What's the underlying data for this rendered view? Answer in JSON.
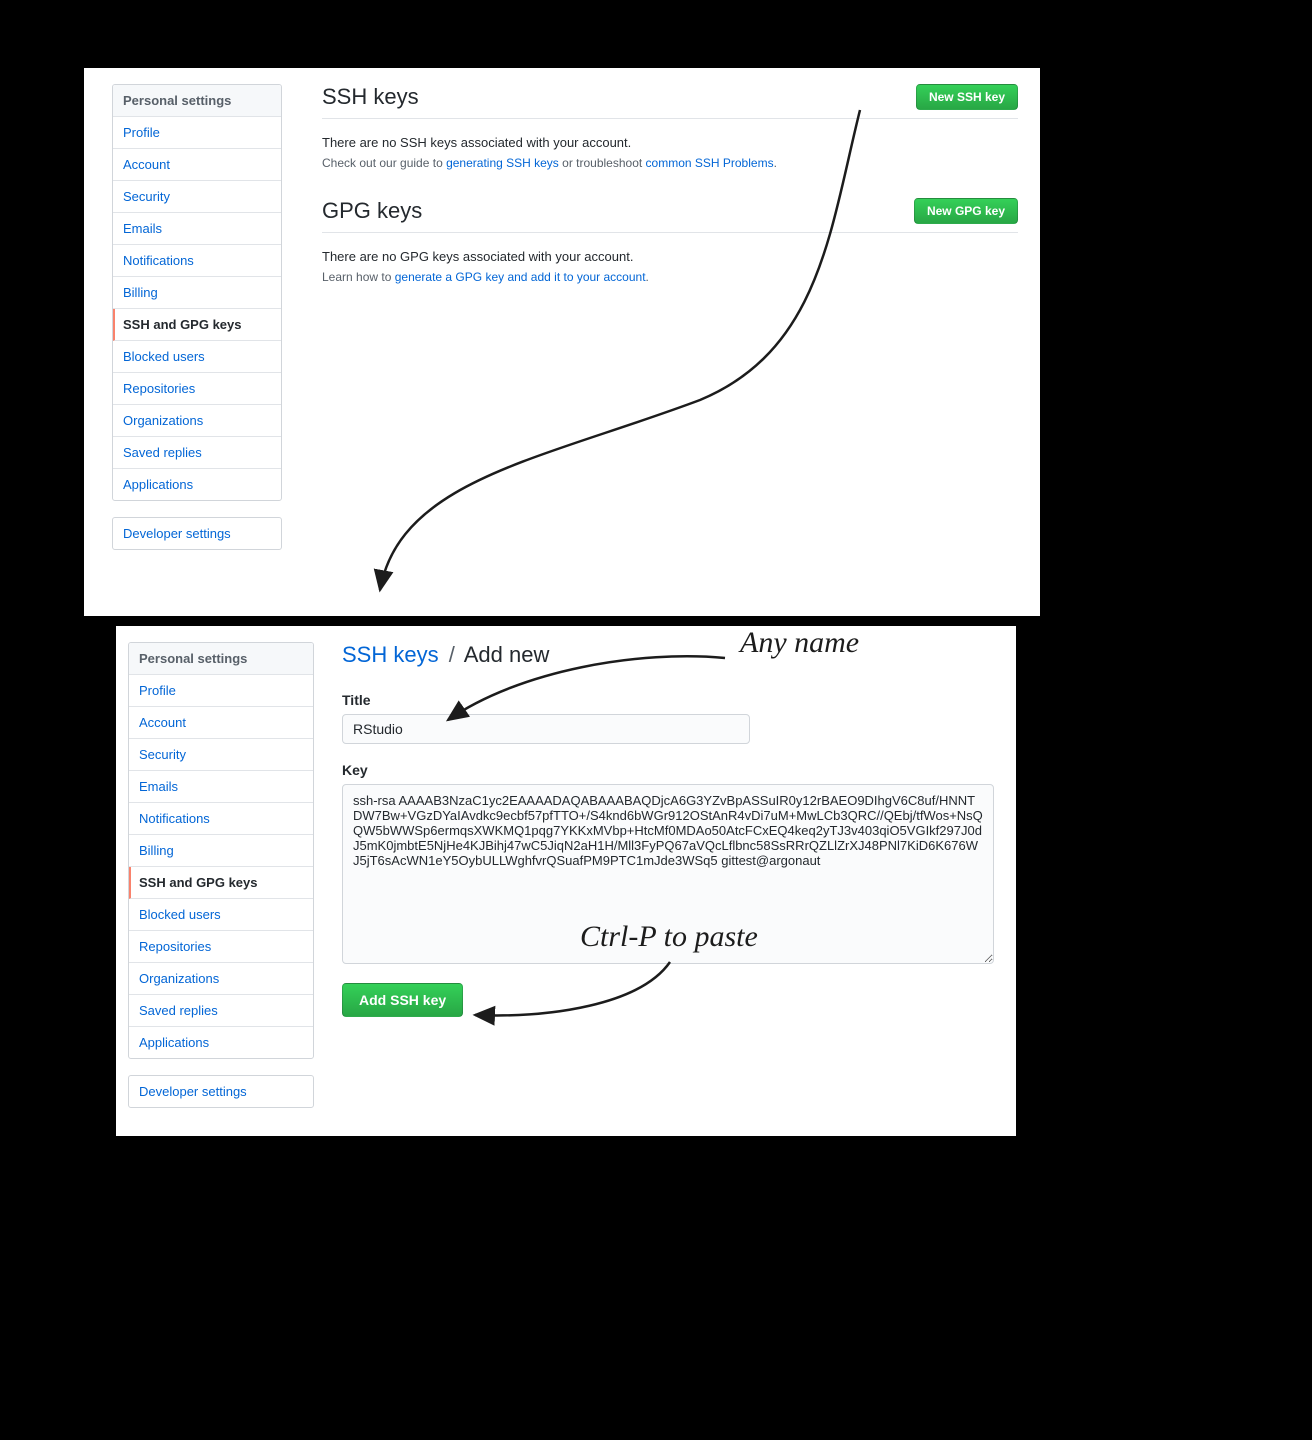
{
  "sidebar": {
    "header": "Personal settings",
    "items": [
      "Profile",
      "Account",
      "Security",
      "Emails",
      "Notifications",
      "Billing",
      "SSH and GPG keys",
      "Blocked users",
      "Repositories",
      "Organizations",
      "Saved replies",
      "Applications"
    ],
    "active_index": 6,
    "developer": "Developer settings"
  },
  "ssh": {
    "title": "SSH keys",
    "button": "New SSH key",
    "empty": "There are no SSH keys associated with your account.",
    "hint_prefix": "Check out our guide to ",
    "hint_link1": "generating SSH keys",
    "hint_mid": " or troubleshoot ",
    "hint_link2": "common SSH Problems",
    "hint_suffix": "."
  },
  "gpg": {
    "title": "GPG keys",
    "button": "New GPG key",
    "empty": "There are no GPG keys associated with your account.",
    "hint_prefix": "Learn how to ",
    "hint_link": "generate a GPG key and add it to your account",
    "hint_suffix": "."
  },
  "addnew": {
    "crumb_link": "SSH keys",
    "crumb_sep": "/",
    "crumb_current": "Add new",
    "title_label": "Title",
    "title_value": "RStudio",
    "key_label": "Key",
    "key_value": "ssh-rsa AAAAB3NzaC1yc2EAAAADAQABAAABAQDjcA6G3YZvBpASSuIR0y12rBAEO9DIhgV6C8uf/HNNTDW7Bw+VGzDYaIAvdkc9ecbf57pfTTO+/S4knd6bWGr912OStAnR4vDi7uM+MwLCb3QRC//QEbj/tfWos+NsQQW5bWWSp6ermqsXWKMQ1pqg7YKKxMVbp+HtcMf0MDAo50AtcFCxEQ4keq2yTJ3v403qiO5VGIkf297J0dJ5mK0jmbtE5NjHe4KJBihj47wC5JiqN2aH1H/Mll3FyPQ67aVQcLflbnc58SsRRrQZLlZrXJ48PNl7KiD6K676WJ5jT6sAcWN1eY5OybULLWghfvrQSuafPM9PTC1mJde3WSq5 gittest@argonaut",
    "submit": "Add SSH key"
  },
  "annotations": {
    "any_name": "Any name",
    "paste": "Ctrl-P to paste"
  }
}
